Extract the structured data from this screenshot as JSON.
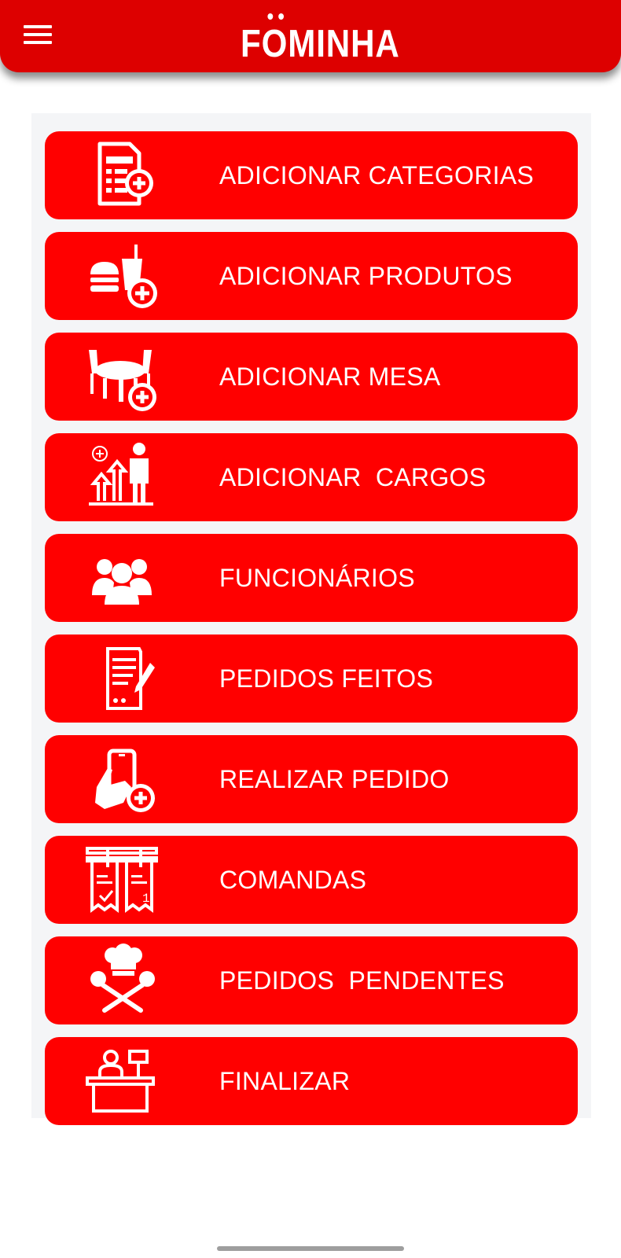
{
  "app": {
    "brand_prefix": "F",
    "brand_umlaut_letter": "O",
    "brand_suffix": "MINHA",
    "accent_color": "#ff0000",
    "appbar_color": "#dd0000"
  },
  "menu": {
    "items": [
      {
        "label": "ADICIONAR CATEGORIAS",
        "icon": "add-category-icon"
      },
      {
        "label": "ADICIONAR PRODUTOS",
        "icon": "add-product-icon"
      },
      {
        "label": "ADICIONAR MESA",
        "icon": "add-table-icon"
      },
      {
        "label": "ADICIONAR  CARGOS",
        "icon": "add-role-icon"
      },
      {
        "label": "FUNCIONÁRIOS",
        "icon": "employees-icon"
      },
      {
        "label": "PEDIDOS FEITOS",
        "icon": "orders-done-icon"
      },
      {
        "label": "REALIZAR PEDIDO",
        "icon": "place-order-icon"
      },
      {
        "label": "COMANDAS",
        "icon": "tabs-icon"
      },
      {
        "label": "PEDIDOS  PENDENTES",
        "icon": "pending-orders-icon"
      },
      {
        "label": "FINALIZAR",
        "icon": "checkout-icon"
      }
    ]
  }
}
